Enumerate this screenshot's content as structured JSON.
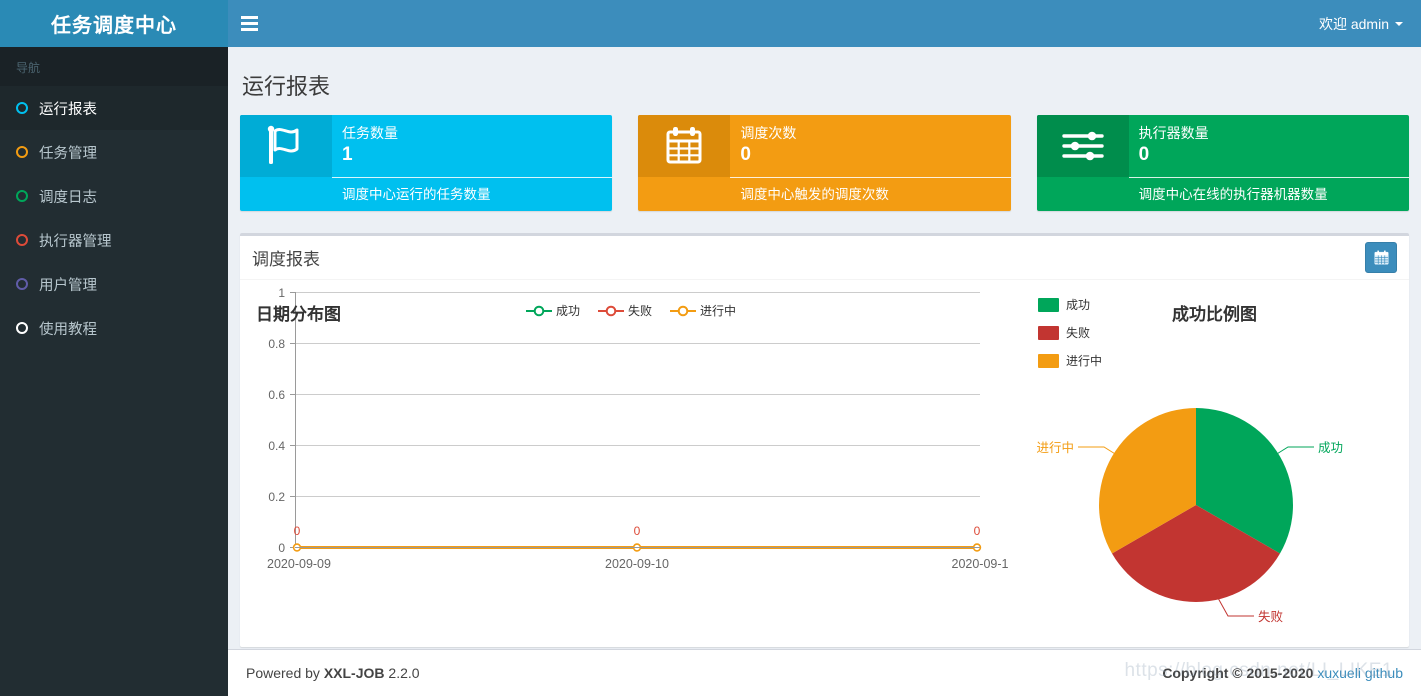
{
  "sidebar": {
    "brand": "任务调度中心",
    "nav_header": "导航",
    "items": [
      {
        "label": "运行报表",
        "icon": "circle-icon",
        "color": "#00c0ef",
        "active": true
      },
      {
        "label": "任务管理",
        "icon": "circle-icon",
        "color": "#f39c12",
        "active": false
      },
      {
        "label": "调度日志",
        "icon": "circle-icon",
        "color": "#00a65a",
        "active": false
      },
      {
        "label": "执行器管理",
        "icon": "circle-icon",
        "color": "#dd4b39",
        "active": false
      },
      {
        "label": "用户管理",
        "icon": "circle-icon",
        "color": "#605ca8",
        "active": false
      },
      {
        "label": "使用教程",
        "icon": "circle-icon",
        "color": "#ffffff",
        "active": false
      }
    ]
  },
  "header": {
    "menu_toggle": "hamburger-icon",
    "user_greeting": "欢迎 admin"
  },
  "page": {
    "title": "运行报表"
  },
  "infoboxes": [
    {
      "title": "任务数量",
      "number": "1",
      "footer": "调度中心运行的任务数量",
      "icon": "flag-icon",
      "color": "#00c0ef"
    },
    {
      "title": "调度次数",
      "number": "0",
      "footer": "调度中心触发的调度次数",
      "icon": "calendar-icon",
      "color": "#f39c12"
    },
    {
      "title": "执行器数量",
      "number": "0",
      "footer": "调度中心在线的执行器机器数量",
      "icon": "sliders-icon",
      "color": "#00a65a"
    }
  ],
  "chart_box": {
    "title": "调度报表",
    "date_picker_icon": "calendar-icon"
  },
  "chart_data": [
    {
      "type": "line",
      "title": "日期分布图",
      "categories": [
        "2020-09-09",
        "2020-09-10",
        "2020-09-1"
      ],
      "series": [
        {
          "name": "成功",
          "values": [
            0,
            0,
            0
          ],
          "color": "#00a65a"
        },
        {
          "name": "失败",
          "values": [
            0,
            0,
            0
          ],
          "color": "#dd4b39"
        },
        {
          "name": "进行中",
          "values": [
            0,
            0,
            0
          ],
          "color": "#f39c12"
        }
      ],
      "point_labels": [
        "0",
        "0",
        "0"
      ],
      "point_label_color": "#dd4b39",
      "ylim": [
        0,
        1
      ],
      "yticks": [
        "0",
        "0.2",
        "0.4",
        "0.6",
        "0.8",
        "1"
      ],
      "xlabel": "",
      "ylabel": "",
      "grid": true,
      "legend": [
        "成功",
        "失败",
        "进行中"
      ],
      "legend_position": "top-center"
    },
    {
      "type": "pie",
      "title": "成功比例图",
      "labels": [
        "成功",
        "失败",
        "进行中"
      ],
      "values": [
        33.3,
        33.3,
        33.3
      ],
      "colors": [
        "#00a65a",
        "#c23531",
        "#f39c12"
      ],
      "legend": [
        "成功",
        "失败",
        "进行中"
      ],
      "legend_position": "top-left"
    }
  ],
  "footer": {
    "powered_prefix": "Powered by",
    "powered_brand": "XXL-JOB",
    "version": "2.2.0",
    "copyright": "Copyright © 2015-2020",
    "link_author": "xuxueli",
    "link_github": "github",
    "watermark": "https://blog.csdn.net/LI_LIKE1"
  }
}
